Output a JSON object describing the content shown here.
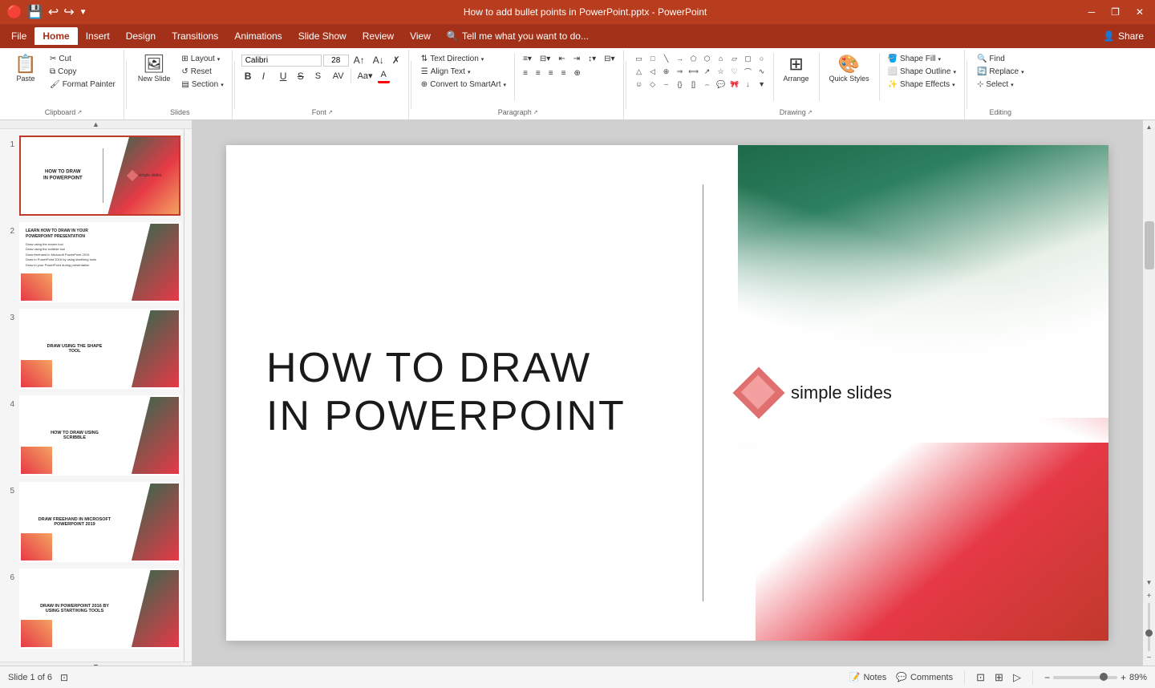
{
  "titleBar": {
    "title": "How to add bullet points in PowerPoint.pptx - PowerPoint",
    "quickAccessIcons": [
      "save",
      "undo",
      "redo",
      "customizeQAT"
    ],
    "windowControls": [
      "minimize",
      "restore",
      "close"
    ]
  },
  "menuBar": {
    "items": [
      "File",
      "Home",
      "Insert",
      "Design",
      "Transitions",
      "Animations",
      "Slide Show",
      "Review",
      "View"
    ],
    "activeItem": "Home",
    "searchPlaceholder": "Tell me what you want to do...",
    "shareLabel": "Share"
  },
  "ribbon": {
    "clipboard": {
      "label": "Clipboard",
      "paste": "Paste",
      "cut": "Cut",
      "copy": "Copy",
      "formatPainter": "Format Painter"
    },
    "slides": {
      "label": "Slides",
      "newSlide": "New Slide",
      "layout": "Layout",
      "reset": "Reset",
      "section": "Section"
    },
    "font": {
      "label": "Font",
      "fontName": "Calibri",
      "fontSize": "28",
      "bold": "B",
      "italic": "I",
      "underline": "U",
      "strikethrough": "S",
      "shadow": "s",
      "characterSpacing": "AV",
      "changeCaseLabel": "Aa",
      "fontColorLabel": "A"
    },
    "paragraph": {
      "label": "Paragraph",
      "textDirection": "Text Direction",
      "alignText": "Align Text",
      "convertToSmartArt": "Convert to SmartArt",
      "bullets": "bullets",
      "numbering": "numbering",
      "decreaseIndent": "decrease",
      "increaseIndent": "increase",
      "lineSpacing": "spacing",
      "columns": "columns"
    },
    "drawing": {
      "label": "Drawing",
      "shapeFill": "Shape Fill",
      "shapeOutline": "Shape Outline",
      "shapeEffects": "Shape Effects",
      "arrange": "Arrange",
      "quickStyles": "Quick Styles"
    },
    "editing": {
      "label": "Editing",
      "find": "Find",
      "replace": "Replace",
      "select": "Select"
    }
  },
  "slides": [
    {
      "num": "1",
      "active": true,
      "title": "HOW TO DRAW\nIN POWERPOINT",
      "type": "title"
    },
    {
      "num": "2",
      "active": false,
      "title": "LEARN HOW TO DRAW IN YOUR\nPOWERPOINT PRESENTATION",
      "type": "content"
    },
    {
      "num": "3",
      "active": false,
      "title": "DRAW USING THE SHAPE\nTOOL",
      "type": "section"
    },
    {
      "num": "4",
      "active": false,
      "title": "HOW TO DRAW USING\nSCRIBBLE",
      "type": "section"
    },
    {
      "num": "5",
      "active": false,
      "title": "DRAW FREEHAND IN MICROSOFT\nPOWERPOINT 2019",
      "type": "section"
    },
    {
      "num": "6",
      "active": false,
      "title": "DRAW IN POWERPOINT 2016 BY\nUSING START/KING TOOLS",
      "type": "section"
    }
  ],
  "mainSlide": {
    "titleLine1": "HOW TO DRAW",
    "titleLine2": "IN POWERPOINT",
    "logoText": "simple slides"
  },
  "statusBar": {
    "slideInfo": "Slide 1 of 6",
    "notes": "Notes",
    "comments": "Comments",
    "zoom": "89%",
    "viewNormal": "normal",
    "viewSlide": "slide-sorter",
    "viewReading": "reading"
  }
}
